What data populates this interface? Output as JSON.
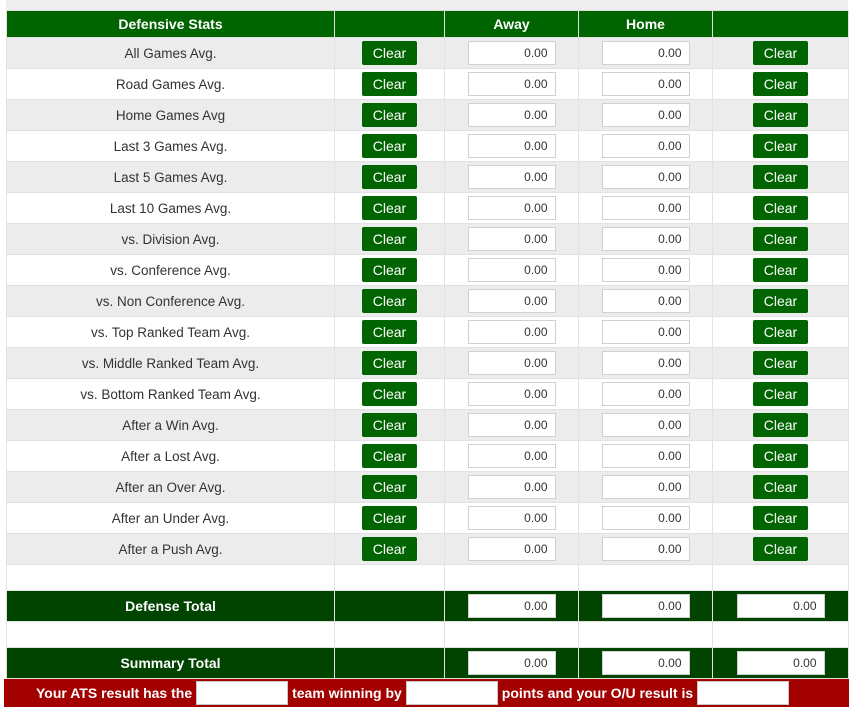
{
  "header": {
    "title": "Defensive Stats",
    "away": "Away",
    "home": "Home"
  },
  "clear_label": "Clear",
  "rows": [
    {
      "label": "All Games Avg.",
      "away": "0.00",
      "home": "0.00"
    },
    {
      "label": "Road Games Avg.",
      "away": "0.00",
      "home": "0.00"
    },
    {
      "label": "Home Games Avg",
      "away": "0.00",
      "home": "0.00"
    },
    {
      "label": "Last 3 Games Avg.",
      "away": "0.00",
      "home": "0.00"
    },
    {
      "label": "Last 5 Games Avg.",
      "away": "0.00",
      "home": "0.00"
    },
    {
      "label": "Last 10 Games Avg.",
      "away": "0.00",
      "home": "0.00"
    },
    {
      "label": "vs. Division Avg.",
      "away": "0.00",
      "home": "0.00"
    },
    {
      "label": "vs. Conference Avg.",
      "away": "0.00",
      "home": "0.00"
    },
    {
      "label": "vs. Non Conference Avg.",
      "away": "0.00",
      "home": "0.00"
    },
    {
      "label": "vs. Top Ranked Team Avg.",
      "away": "0.00",
      "home": "0.00"
    },
    {
      "label": "vs. Middle Ranked Team Avg.",
      "away": "0.00",
      "home": "0.00"
    },
    {
      "label": "vs. Bottom Ranked Team Avg.",
      "away": "0.00",
      "home": "0.00"
    },
    {
      "label": "After a Win Avg.",
      "away": "0.00",
      "home": "0.00"
    },
    {
      "label": "After a Lost Avg.",
      "away": "0.00",
      "home": "0.00"
    },
    {
      "label": "After an Over Avg.",
      "away": "0.00",
      "home": "0.00"
    },
    {
      "label": "After an Under Avg.",
      "away": "0.00",
      "home": "0.00"
    },
    {
      "label": "After a Push Avg.",
      "away": "0.00",
      "home": "0.00"
    }
  ],
  "defense_total": {
    "label": "Defense Total",
    "away": "0.00",
    "home": "0.00",
    "total": "0.00"
  },
  "summary_total": {
    "label": "Summary Total",
    "away": "0.00",
    "home": "0.00",
    "total": "0.00"
  },
  "result": {
    "part1": "Your ATS result has the",
    "part2": "team winning by",
    "part3": "points and your O/U result is",
    "ats_team": "",
    "winning_by": "",
    "ou_result": ""
  },
  "colors": {
    "header_green": "#006400",
    "total_green": "#004400",
    "result_red": "#a30000",
    "row_alt": "#ececec"
  }
}
